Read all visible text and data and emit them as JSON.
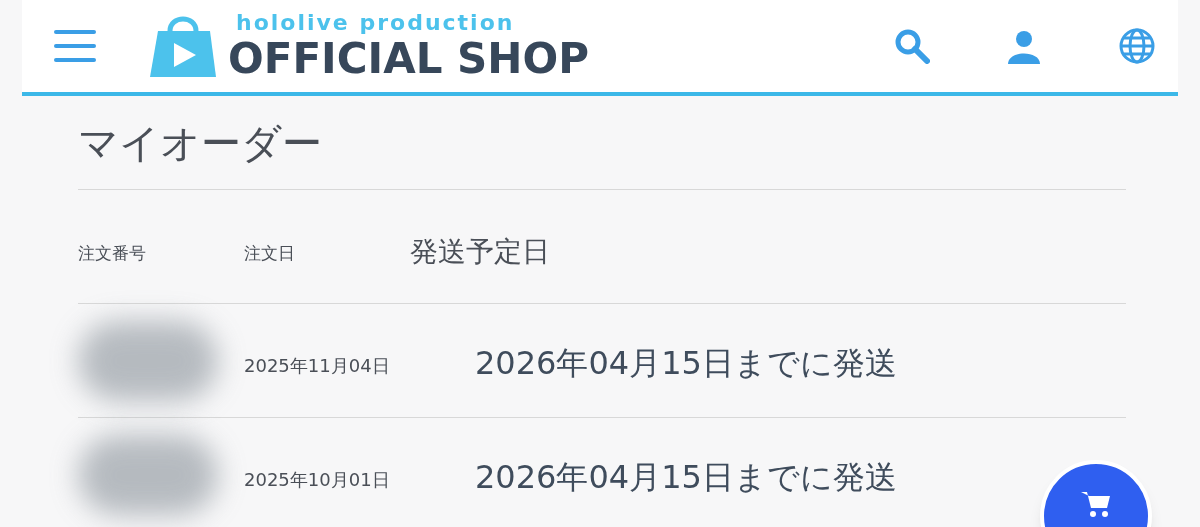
{
  "header": {
    "brand_sub": "hololive production",
    "brand_main": "OFFICIAL SHOP"
  },
  "title": "マイオーダー",
  "columns": [
    "注文番号",
    "注文日",
    "発送予定日"
  ],
  "rows": [
    {
      "order_date": "2025年11月04日",
      "ship_date": "2026年04月15日までに発送"
    },
    {
      "order_date": "2025年10月01日",
      "ship_date": "2026年04月15日までに発送"
    }
  ]
}
